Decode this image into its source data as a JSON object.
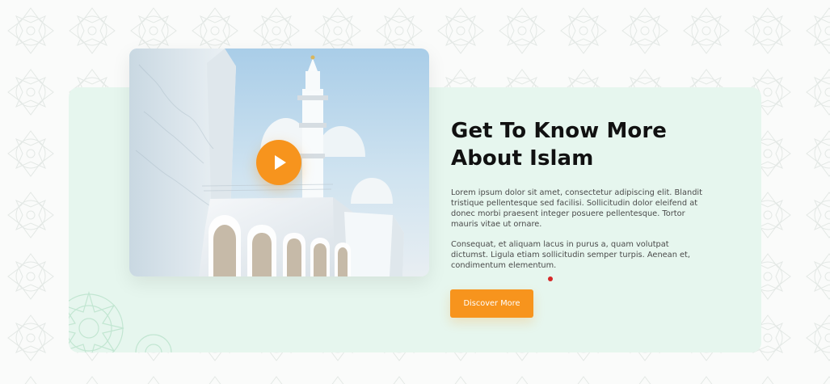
{
  "colors": {
    "accent": "#f7941d",
    "panel_background": "#e6f6ee",
    "text_dark": "#111111",
    "text_body": "#4b4b4b",
    "small_dot": "#d62828"
  },
  "section": {
    "title": "Get To Know More About Islam",
    "paragraphs": [
      "Lorem ipsum dolor sit amet, consectetur adipiscing elit. Blandit tristique pellentesque sed facilisi. Sollicitudin dolor eleifend at donec morbi praesent integer posuere pellentesque. Tortor mauris vitae ut ornare.",
      "Consequat, et aliquam lacus in purus a, quam volutpat dictumst. Ligula etiam sollicitudin semper turpis. Aenean et, condimentum elementum."
    ],
    "button_label": "Discover More"
  },
  "media": {
    "play_icon": "play-icon",
    "image_icon": "mosque-image"
  },
  "decor": {
    "pattern_icon": "geometric-pattern-icon",
    "floral_icon": "floral-ornament-icon"
  }
}
